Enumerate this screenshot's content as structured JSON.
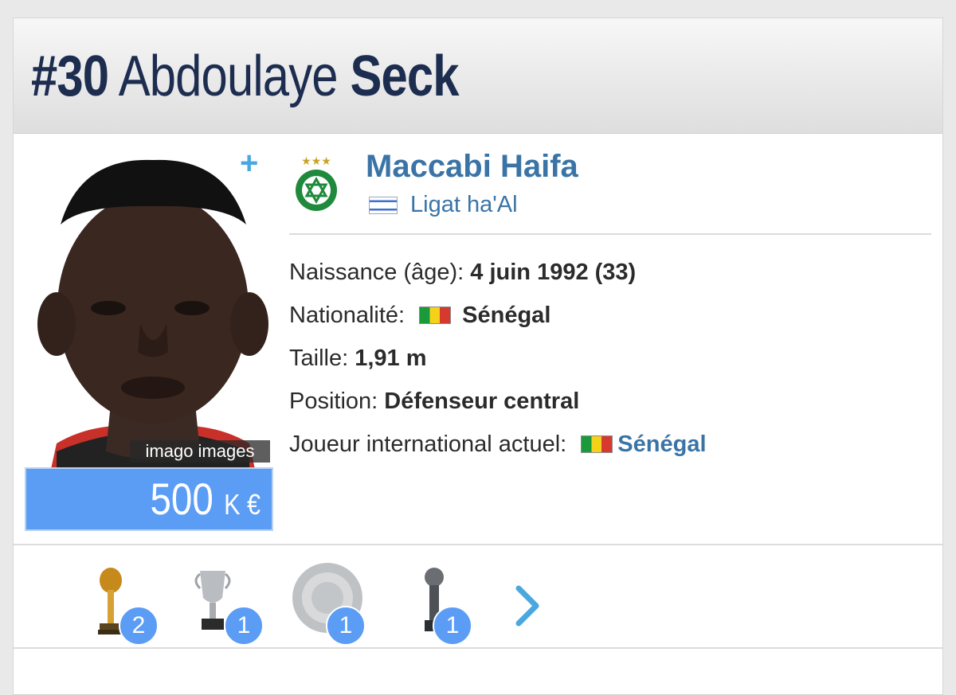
{
  "header": {
    "number": "#30",
    "first_name": "Abdoulaye",
    "last_name": "Seck"
  },
  "profile": {
    "plus_label": "+",
    "photo_credit": "imago images",
    "market_value": "500",
    "market_value_unit": "K €"
  },
  "club": {
    "name": "Maccabi Haifa",
    "league": "Ligat ha'Al",
    "logo_icon": "maccabi-haifa-crest-icon",
    "league_flag_icon": "israel-flag-icon"
  },
  "details": {
    "birth_label": "Naissance (âge):",
    "birth_value": "4 juin 1992 (33)",
    "nationality_label": "Nationalité:",
    "nationality_value": "Sénégal",
    "height_label": "Taille:",
    "height_value": "1,91 m",
    "position_label": "Position:",
    "position_value": "Défenseur central",
    "international_label": "Joueur international actuel:",
    "international_value": "Sénégal"
  },
  "trophies": [
    {
      "icon": "africa-cup-trophy-icon",
      "count": "2"
    },
    {
      "icon": "silver-cup-trophy-icon",
      "count": "1"
    },
    {
      "icon": "silver-plate-trophy-icon",
      "count": "1"
    },
    {
      "icon": "award-trophy-icon",
      "count": "1"
    }
  ],
  "colors": {
    "accent_blue": "#3a74a6",
    "badge_blue": "#5b9cf5",
    "title_navy": "#1d2d50"
  }
}
